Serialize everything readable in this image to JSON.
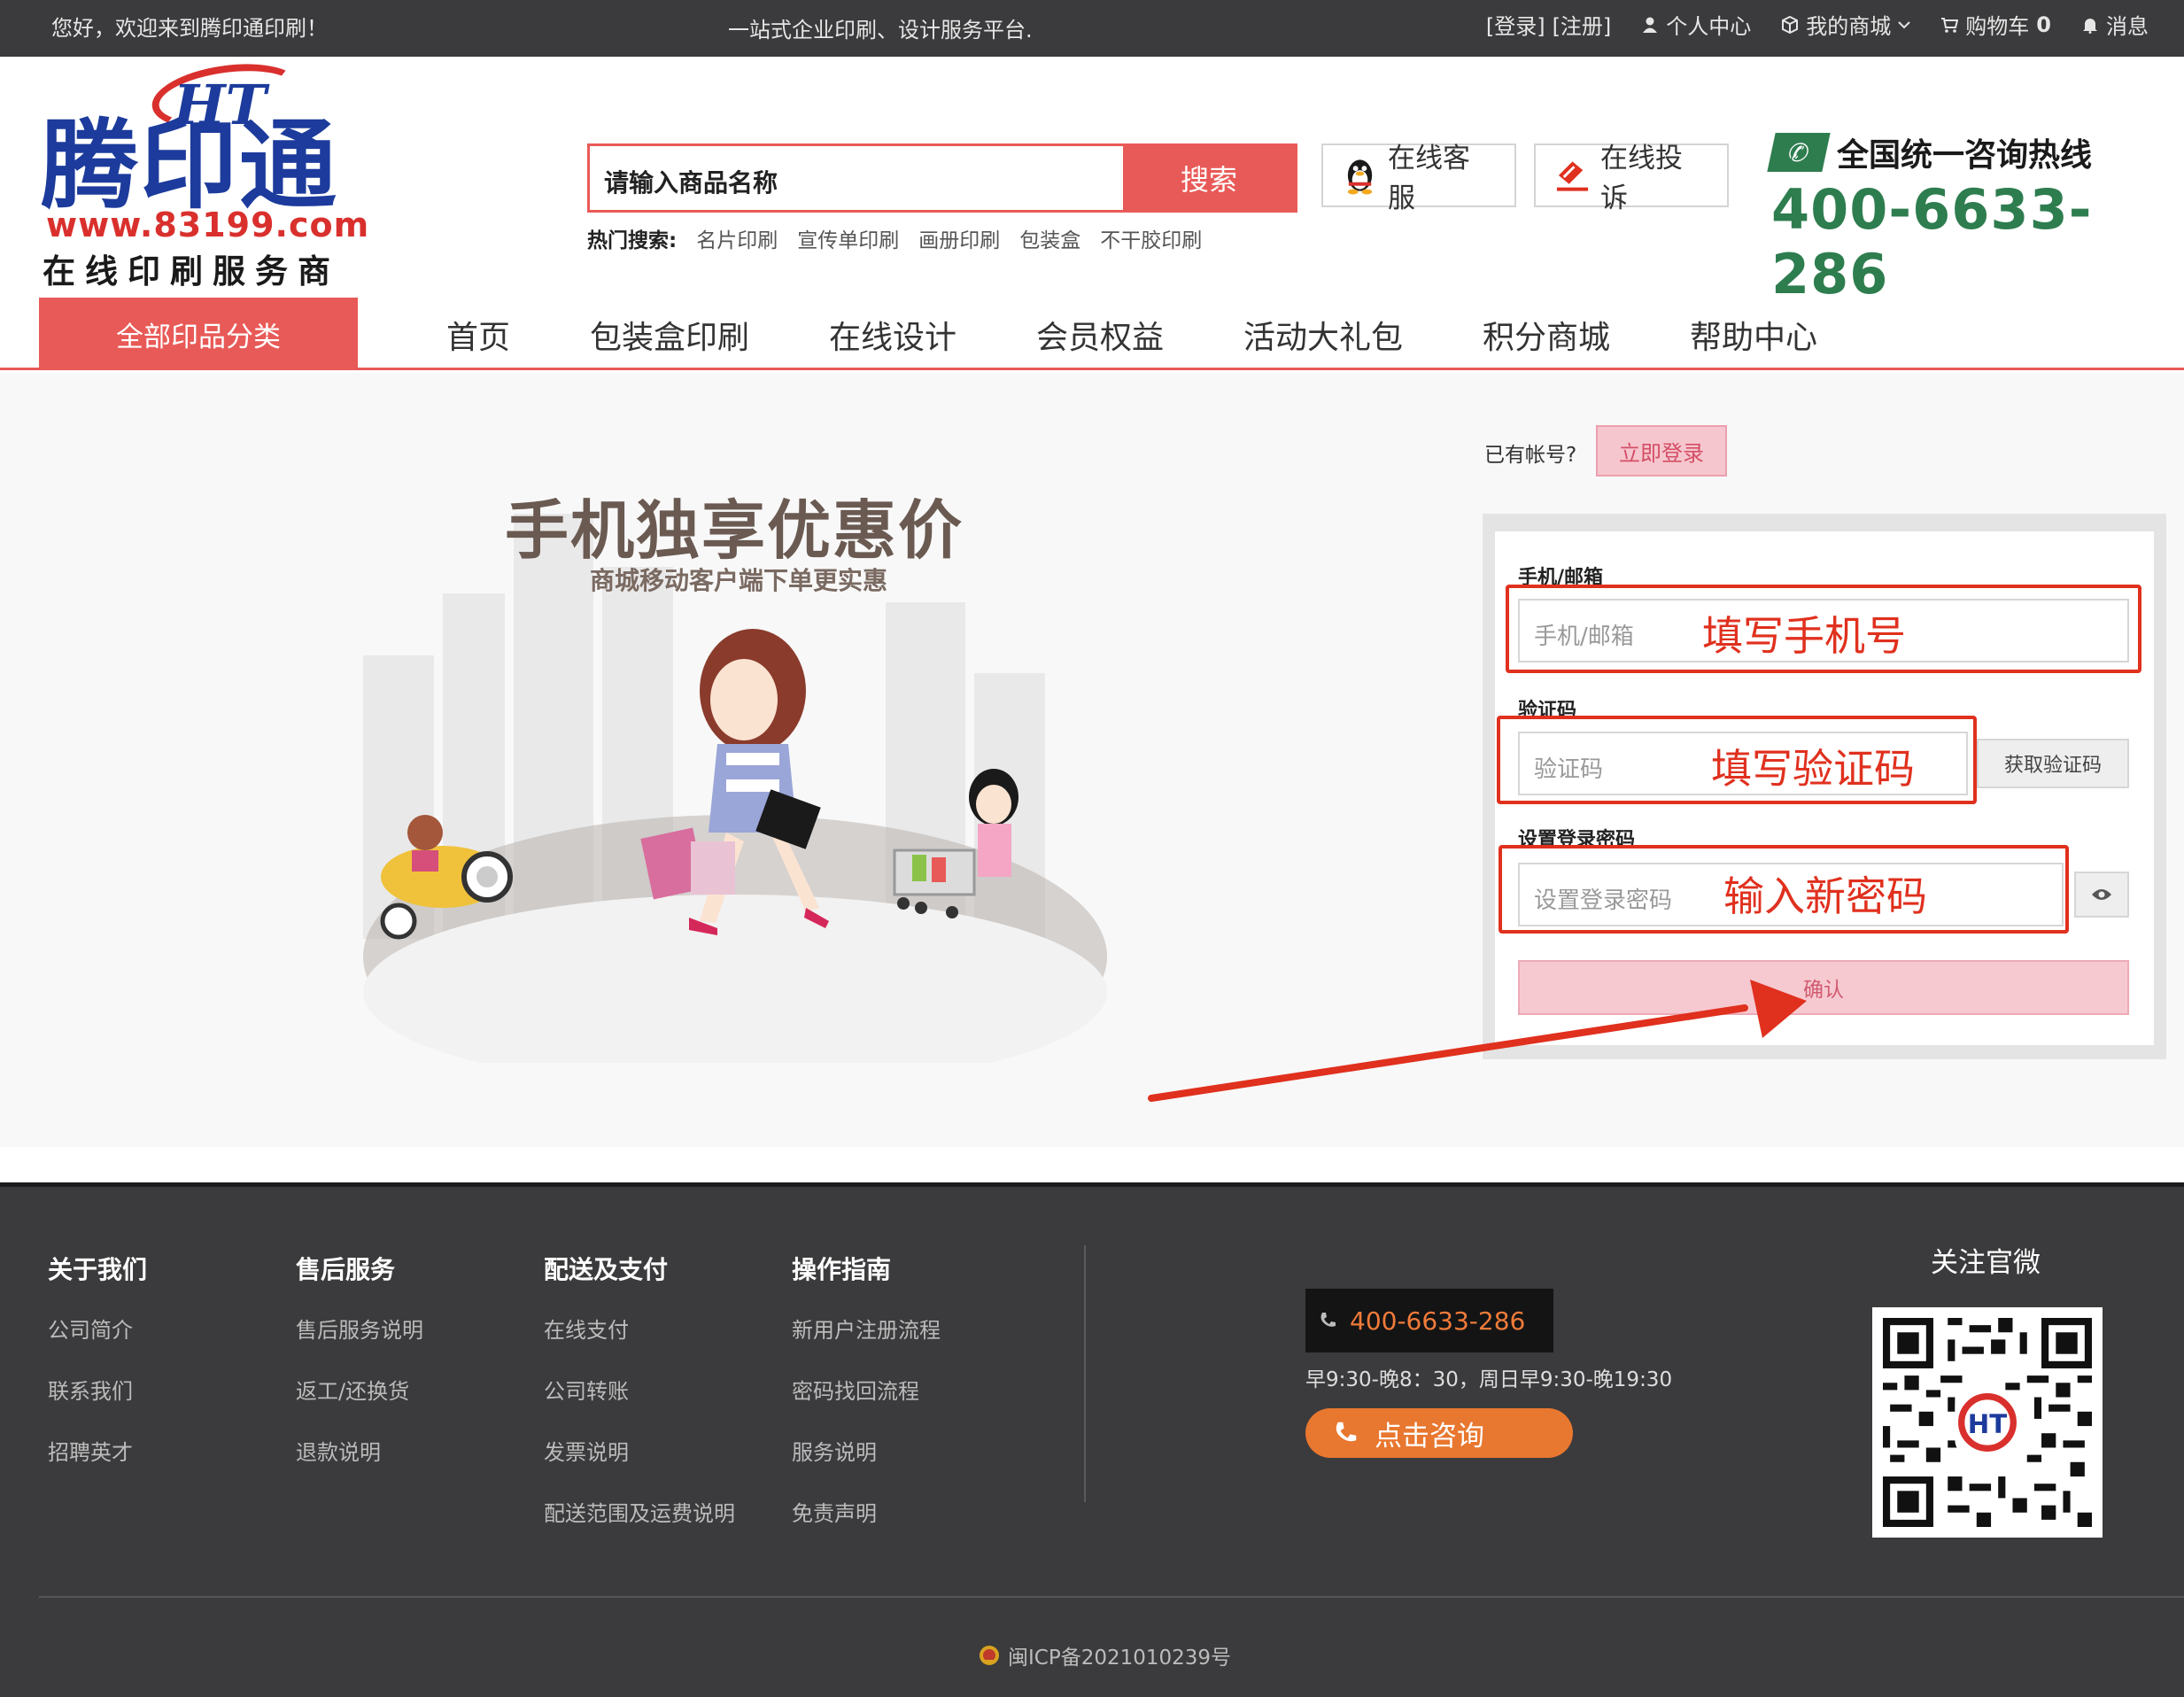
{
  "topbar": {
    "welcome": "您好，欢迎来到腾印通印刷！",
    "slogan": "一站式企业印刷、设计服务平台.",
    "login": "[登录]",
    "register": "[注册]",
    "personal_center": "个人中心",
    "my_mall": "我的商城",
    "cart": "购物车",
    "cart_count": "0",
    "messages": "消息"
  },
  "logo": {
    "brand": "腾印通",
    "url": "www.83199.com",
    "tagline": "在线印刷服务商"
  },
  "search": {
    "placeholder": "请输入商品名称",
    "button": "搜索",
    "hot_label": "热门搜索:",
    "hot_terms": [
      "名片印刷",
      "宣传单印刷",
      "画册印刷",
      "包装盒",
      "不干胶印刷"
    ]
  },
  "service": {
    "online_service": "在线客服",
    "online_complaint": "在线投诉"
  },
  "hotline": {
    "label": "全国统一咨询热线",
    "number": "400-6633-286"
  },
  "nav": {
    "all_categories": "全部印品分类",
    "items": [
      "首页",
      "包装盒印刷",
      "在线设计",
      "会员权益",
      "活动大礼包",
      "积分商城",
      "帮助中心"
    ]
  },
  "promo": {
    "title": "手机独享优惠价",
    "subtitle": "商城移动客户端下单更实惠"
  },
  "auth": {
    "has_account": "已有帐号?",
    "login_now": "立即登录",
    "phone_label": "手机/邮箱",
    "phone_placeholder": "手机/邮箱",
    "phone_hint": "填写手机号",
    "code_label": "验证码",
    "code_placeholder": "验证码",
    "code_hint": "填写验证码",
    "get_code": "获取验证码",
    "password_label": "设置登录密码",
    "password_placeholder": "设置登录密码",
    "password_hint": "输入新密码",
    "confirm": "确认"
  },
  "footer": {
    "columns": [
      {
        "title": "关于我们",
        "links": [
          "公司简介",
          "联系我们",
          "招聘英才"
        ]
      },
      {
        "title": "售后服务",
        "links": [
          "售后服务说明",
          "返工/还换货",
          "退款说明"
        ]
      },
      {
        "title": "配送及支付",
        "links": [
          "在线支付",
          "公司转账",
          "发票说明",
          "配送范围及运费说明"
        ]
      },
      {
        "title": "操作指南",
        "links": [
          "新用户注册流程",
          "密码找回流程",
          "服务说明",
          "免责声明"
        ]
      }
    ],
    "phone": "400-6633-286",
    "hours": "早9:30-晚8：30，周日早9:30-晚19:30",
    "consult": "点击咨询",
    "follow": "关注官微",
    "icp": "闽ICP备2021010239号"
  },
  "colors": {
    "accent": "#e85a57",
    "annotation": "#e0301e",
    "hotline_green": "#2e7d4f",
    "footer_bg": "#3b3b3d"
  }
}
